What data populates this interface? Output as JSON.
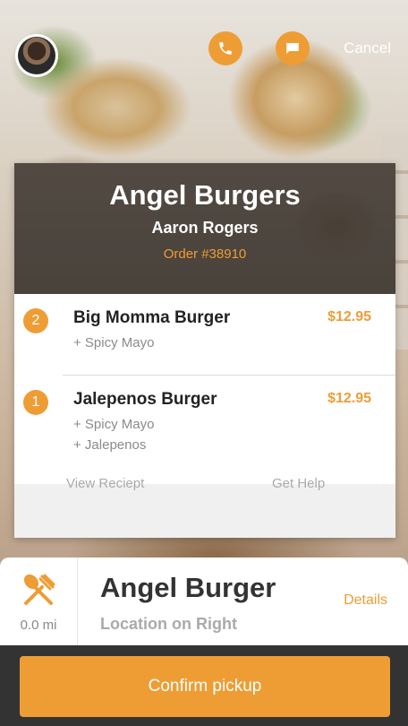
{
  "header": {
    "cancel_label": "Cancel",
    "call_icon": "phone-icon",
    "message_icon": "chat-icon",
    "avatar": "driver-avatar"
  },
  "order": {
    "restaurant": "Angel Burgers",
    "customer": "Aaron Rogers",
    "order_number": "Order #38910",
    "items": [
      {
        "qty": "2",
        "name": "Big Momma Burger",
        "price": "$12.95",
        "mods": [
          "+ Spicy Mayo"
        ]
      },
      {
        "qty": "1",
        "name": "Jalepenos Burger",
        "price": "$12.95",
        "mods": [
          "+ Spicy Mayo",
          "+ Jalepenos"
        ]
      }
    ],
    "links": {
      "receipt": "View Reciept",
      "help": "Get Help"
    }
  },
  "destination": {
    "distance": "0.0 mi",
    "name": "Angel Burger",
    "subtitle": "Location on Right",
    "details_label": "Details",
    "icon": "fork-spoon-icon"
  },
  "action": {
    "confirm_label": "Confirm pickup"
  },
  "colors": {
    "accent": "#ee9d35",
    "dark": "#333333"
  }
}
